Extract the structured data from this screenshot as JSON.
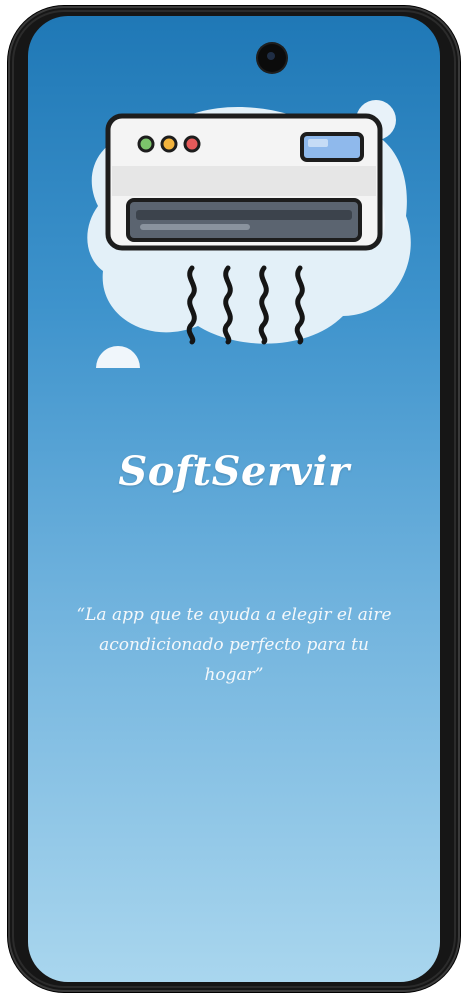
{
  "app": {
    "title": "SoftServir",
    "tagline": "“La app que te ayuda a elegir el aire acondicionado perfecto para tu hogar”"
  },
  "illustration": {
    "icon": "air-conditioner-icon",
    "status_dots": [
      "#7cc46b",
      "#f2b33d",
      "#e55a5a"
    ],
    "display_color": "#8fb9ec"
  },
  "colors": {
    "background_top": "#1f78b6",
    "background_bottom": "#a9d6ee",
    "text": "#ffffff"
  }
}
